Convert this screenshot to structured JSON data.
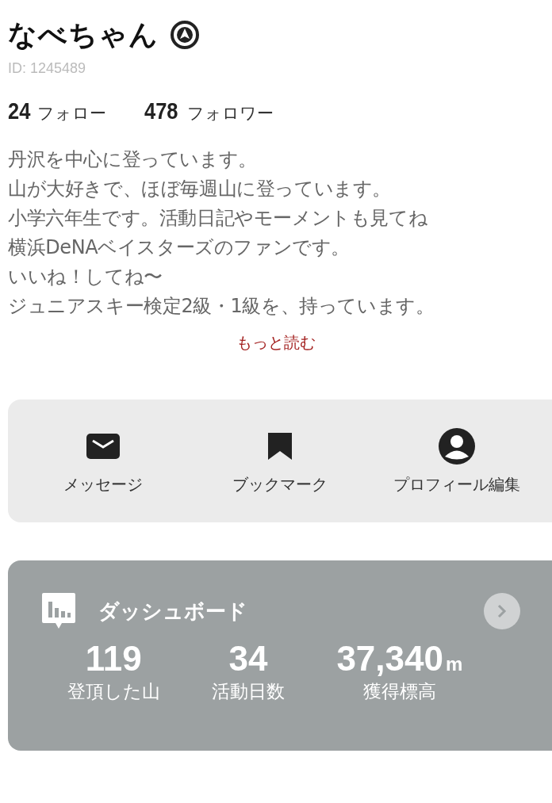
{
  "profile": {
    "name": "なべちゃん",
    "id": "ID: 1245489"
  },
  "follow_stats": [
    {
      "count": "24",
      "label": "フォロー"
    },
    {
      "count": "478",
      "label": "フォロワー"
    }
  ],
  "bio": [
    "丹沢を中心に登っています。",
    "山が大好きで、ほぼ毎週山に登っています。",
    "小学六年生です。活動日記やモーメントも見てね",
    "横浜DeNAベイスターズのファンです。",
    "いいね！してね〜",
    "ジュニアスキー検定2級・1級を、持っています。"
  ],
  "read_more": "もっと読む",
  "actions": [
    {
      "kind": "mail",
      "label": "メッセージ"
    },
    {
      "kind": "bookmark",
      "label": "ブックマーク"
    },
    {
      "kind": "person",
      "label": "プロフィール編集"
    }
  ],
  "dashboard": {
    "title": "ダッシュボード",
    "stats": [
      {
        "value": "119",
        "label": "登頂した山"
      },
      {
        "value": "34",
        "label": "活動日数"
      },
      {
        "value": "37,340",
        "unit": "m",
        "label": "獲得標高"
      }
    ]
  }
}
